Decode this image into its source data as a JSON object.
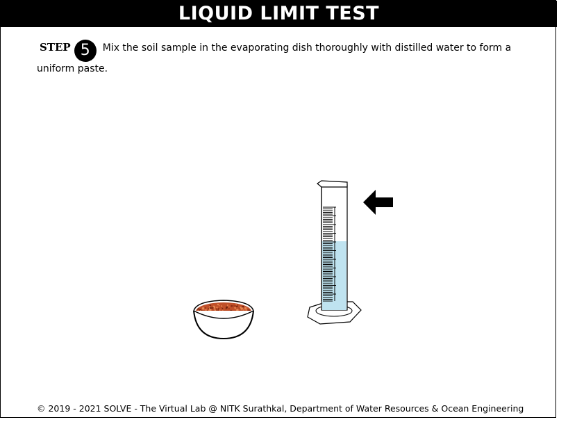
{
  "header": {
    "title": "LIQUID LIMIT TEST"
  },
  "step": {
    "label": "STEP",
    "number": "5",
    "instruction": "Mix the soil sample in the evaporating dish thoroughly with distilled water to form a uniform paste."
  },
  "apparatus": {
    "cylinder_water_level": 0.55,
    "water_color": "#bfe3f0",
    "soil_color": "#c0502a"
  },
  "footer": {
    "text": "© 2019 - 2021 SOLVE - The Virtual Lab @ NITK Surathkal, Department of Water Resources & Ocean Engineering"
  }
}
